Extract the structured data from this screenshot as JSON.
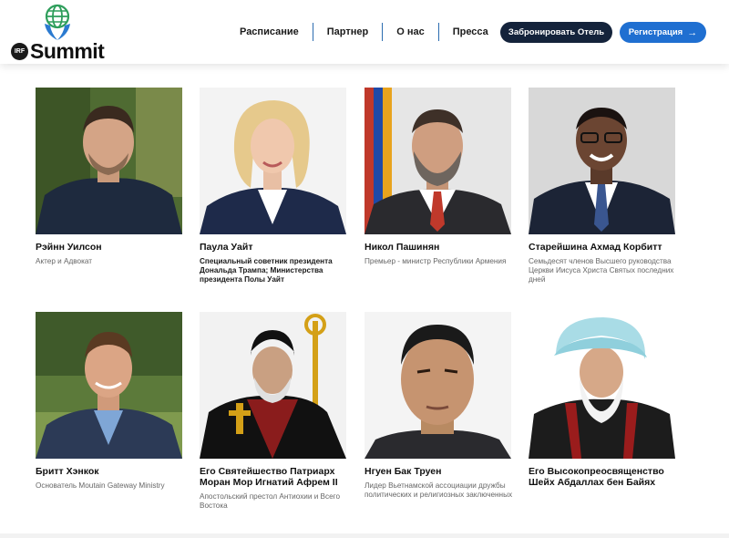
{
  "header": {
    "logo_badge": "IRF",
    "logo_word": "Summit",
    "nav": [
      "Расписание",
      "Партнер",
      "О нас",
      "Пресса"
    ],
    "book_hotel": "Забронировать Отель",
    "register": "Регистрация",
    "register_arrow": "→"
  },
  "speakers": [
    {
      "name": "Рэйнн Уилсон",
      "role": "Актер и Адвокат",
      "role_style": "light"
    },
    {
      "name": "Паула Уайт",
      "role": "Специальный советник президента Дональда Трампа; Министерства президента Полы Уайт",
      "role_style": "dark"
    },
    {
      "name": "Никол Пашинян",
      "role": "Премьер - министр Республики Армения",
      "role_style": "light"
    },
    {
      "name": "Старейшина Ахмад Корбитт",
      "role": "Семьдесят членов Высшего руководства Церкви Иисуса Христа Святых последних дней",
      "role_style": "light"
    },
    {
      "name": "Бритт Хэнкок",
      "role": "Основатель Moutain Gateway Ministry",
      "role_style": "light"
    },
    {
      "name": "Его Святейшество Патриарх Моран Мор Игнатий Афрем II",
      "role": "Апостольский престол Антиохии и Всего Востока",
      "role_style": "light"
    },
    {
      "name": "Нгуен Бак Труен",
      "role": "Лидер Вьетнамской ассоциации дружбы политических и религиозных заключенных",
      "role_style": "light"
    },
    {
      "name": "Его Высокопреосвященство Шейх Абдаллах бен Байях",
      "role": "",
      "role_style": "light"
    }
  ]
}
